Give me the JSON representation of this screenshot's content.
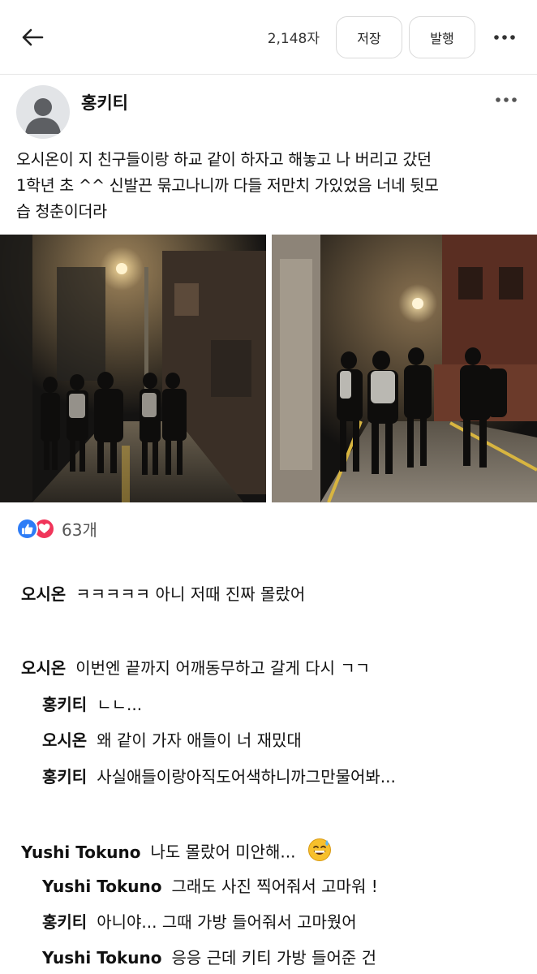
{
  "header": {
    "back_icon": "arrow-left-icon",
    "char_count": "2,148자",
    "save_label": "저장",
    "publish_label": "발행",
    "more_icon": "more-horizontal-icon"
  },
  "post": {
    "author": "홍키티",
    "text_lines": [
      "오시온이 지 친구들이랑 하교 같이 하자고 해놓고 나 버리고 갔던",
      "1학년 초 ^^ 신발끈 묶고나니까 다들 저만치 가있었음 너네 뒷모",
      "습 청춘이더라"
    ],
    "photos": [
      "photo-night-alley-1",
      "photo-night-alley-2"
    ]
  },
  "reactions": {
    "icons": [
      "thumbs-up-icon",
      "heart-icon"
    ],
    "count": "63개"
  },
  "comments": [
    {
      "name": "오시온",
      "text": "ㅋㅋㅋㅋㅋ 아니 저때 진짜 몰랐어",
      "level": 0
    },
    {
      "name": "오시온",
      "text": "이번엔 끝까지 어깨동무하고 갈게 다시 ㄱㄱ",
      "level": 0
    },
    {
      "name": "홍키티",
      "text": "ㄴㄴ...",
      "level": 1
    },
    {
      "name": "오시온",
      "text": "왜 같이 가자 애들이 너 재밌대",
      "level": 1
    },
    {
      "name": "홍키티",
      "text": "사실애들이랑아직도어색하니까그만물어봐...",
      "level": 1
    },
    {
      "name": "Yushi Tokuno",
      "text": "나도 몰랐어 미안해...",
      "level": 0,
      "emoji": "sweat-smile-emoji"
    },
    {
      "name": "Yushi Tokuno",
      "text": "그래도 사진 찍어줘서 고마워 !",
      "level": 1
    },
    {
      "name": "홍키티",
      "text": "아니야... 그때 가방 들어줘서 고마웠어",
      "level": 1
    },
    {
      "name": "Yushi Tokuno",
      "text": "응응 근데 키티 가방 들어준 건",
      "level": 1
    }
  ]
}
